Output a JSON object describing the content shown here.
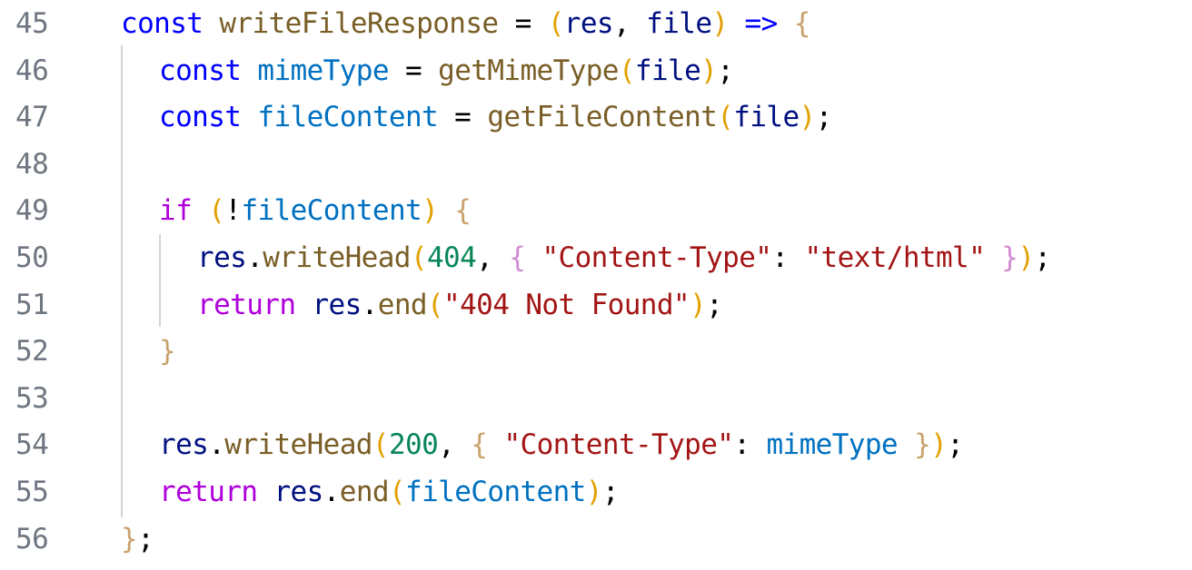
{
  "editor": {
    "lines": [
      {
        "number": "45",
        "tokens": [
          {
            "t": "kw",
            "v": "const"
          },
          {
            "t": "op",
            "v": " "
          },
          {
            "t": "fn",
            "v": "writeFileResponse"
          },
          {
            "t": "op",
            "v": " = "
          },
          {
            "t": "br1",
            "v": "("
          },
          {
            "t": "param",
            "v": "res"
          },
          {
            "t": "punc",
            "v": ", "
          },
          {
            "t": "param",
            "v": "file"
          },
          {
            "t": "br1",
            "v": ")"
          },
          {
            "t": "op",
            "v": " "
          },
          {
            "t": "kw",
            "v": "=>"
          },
          {
            "t": "op",
            "v": " "
          },
          {
            "t": "br3",
            "v": "{"
          }
        ]
      },
      {
        "number": "46",
        "indent": 1,
        "tokens": [
          {
            "t": "kw",
            "v": "const"
          },
          {
            "t": "op",
            "v": " "
          },
          {
            "t": "var",
            "v": "mimeType"
          },
          {
            "t": "op",
            "v": " = "
          },
          {
            "t": "fn",
            "v": "getMimeType"
          },
          {
            "t": "br1",
            "v": "("
          },
          {
            "t": "param",
            "v": "file"
          },
          {
            "t": "br1",
            "v": ")"
          },
          {
            "t": "punc",
            "v": ";"
          }
        ]
      },
      {
        "number": "47",
        "indent": 1,
        "tokens": [
          {
            "t": "kw",
            "v": "const"
          },
          {
            "t": "op",
            "v": " "
          },
          {
            "t": "var",
            "v": "fileContent"
          },
          {
            "t": "op",
            "v": " = "
          },
          {
            "t": "fn",
            "v": "getFileContent"
          },
          {
            "t": "br1",
            "v": "("
          },
          {
            "t": "param",
            "v": "file"
          },
          {
            "t": "br1",
            "v": ")"
          },
          {
            "t": "punc",
            "v": ";"
          }
        ]
      },
      {
        "number": "48",
        "indent": 1,
        "tokens": []
      },
      {
        "number": "49",
        "indent": 1,
        "tokens": [
          {
            "t": "ctrl",
            "v": "if"
          },
          {
            "t": "op",
            "v": " "
          },
          {
            "t": "br1",
            "v": "("
          },
          {
            "t": "op",
            "v": "!"
          },
          {
            "t": "var",
            "v": "fileContent"
          },
          {
            "t": "br1",
            "v": ")"
          },
          {
            "t": "op",
            "v": " "
          },
          {
            "t": "br3",
            "v": "{"
          }
        ]
      },
      {
        "number": "50",
        "indent": 2,
        "tokens": [
          {
            "t": "obj",
            "v": "res"
          },
          {
            "t": "punc",
            "v": "."
          },
          {
            "t": "fn",
            "v": "writeHead"
          },
          {
            "t": "br1",
            "v": "("
          },
          {
            "t": "num",
            "v": "404"
          },
          {
            "t": "punc",
            "v": ", "
          },
          {
            "t": "br2",
            "v": "{"
          },
          {
            "t": "op",
            "v": " "
          },
          {
            "t": "str",
            "v": "\"Content-Type\""
          },
          {
            "t": "punc",
            "v": ": "
          },
          {
            "t": "str",
            "v": "\"text/html\""
          },
          {
            "t": "op",
            "v": " "
          },
          {
            "t": "br2",
            "v": "}"
          },
          {
            "t": "br1",
            "v": ")"
          },
          {
            "t": "punc",
            "v": ";"
          }
        ]
      },
      {
        "number": "51",
        "indent": 2,
        "tokens": [
          {
            "t": "ctrl",
            "v": "return"
          },
          {
            "t": "op",
            "v": " "
          },
          {
            "t": "obj",
            "v": "res"
          },
          {
            "t": "punc",
            "v": "."
          },
          {
            "t": "fn",
            "v": "end"
          },
          {
            "t": "br1",
            "v": "("
          },
          {
            "t": "str",
            "v": "\"404 Not Found\""
          },
          {
            "t": "br1",
            "v": ")"
          },
          {
            "t": "punc",
            "v": ";"
          }
        ]
      },
      {
        "number": "52",
        "indent": 1,
        "tokens": [
          {
            "t": "br3",
            "v": "}"
          }
        ]
      },
      {
        "number": "53",
        "indent": 1,
        "tokens": []
      },
      {
        "number": "54",
        "indent": 1,
        "tokens": [
          {
            "t": "obj",
            "v": "res"
          },
          {
            "t": "punc",
            "v": "."
          },
          {
            "t": "fn",
            "v": "writeHead"
          },
          {
            "t": "br1",
            "v": "("
          },
          {
            "t": "num",
            "v": "200"
          },
          {
            "t": "punc",
            "v": ", "
          },
          {
            "t": "br3",
            "v": "{"
          },
          {
            "t": "op",
            "v": " "
          },
          {
            "t": "str",
            "v": "\"Content-Type\""
          },
          {
            "t": "punc",
            "v": ": "
          },
          {
            "t": "var",
            "v": "mimeType"
          },
          {
            "t": "op",
            "v": " "
          },
          {
            "t": "br3",
            "v": "}"
          },
          {
            "t": "br1",
            "v": ")"
          },
          {
            "t": "punc",
            "v": ";"
          }
        ]
      },
      {
        "number": "55",
        "indent": 1,
        "tokens": [
          {
            "t": "ctrl",
            "v": "return"
          },
          {
            "t": "op",
            "v": " "
          },
          {
            "t": "obj",
            "v": "res"
          },
          {
            "t": "punc",
            "v": "."
          },
          {
            "t": "fn",
            "v": "end"
          },
          {
            "t": "br1",
            "v": "("
          },
          {
            "t": "var",
            "v": "fileContent"
          },
          {
            "t": "br1",
            "v": ")"
          },
          {
            "t": "punc",
            "v": ";"
          }
        ]
      },
      {
        "number": "56",
        "tokens": [
          {
            "t": "br3",
            "v": "}"
          },
          {
            "t": "punc",
            "v": ";"
          }
        ]
      }
    ],
    "colors": {
      "keyword": "#0000ff",
      "control": "#af00db",
      "function": "#795e26",
      "variable": "#0070c1",
      "parameter": "#001080",
      "string": "#a31515",
      "number": "#098658",
      "bracket_level1": "#e2a000",
      "bracket_level2": "#d18bd1",
      "bracket_level3": "#c9a26d",
      "line_number": "#6e7681",
      "indent_guide": "#d4d4d4",
      "background": "#ffffff"
    }
  }
}
